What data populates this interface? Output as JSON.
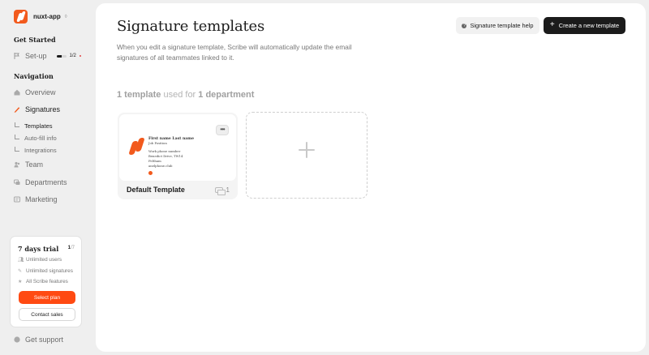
{
  "brand": {
    "name": "nuxt-app",
    "caret": "◊"
  },
  "sidebar": {
    "get_started_title": "Get Started",
    "setup": {
      "label": "Set-up",
      "progress_text": "1/2",
      "progress_fraction": 0.5
    },
    "navigation_title": "Navigation",
    "items": [
      {
        "label": "Overview",
        "icon": "home-icon"
      },
      {
        "label": "Signatures",
        "icon": "pen-icon"
      },
      {
        "label": "Team",
        "icon": "people-icon"
      },
      {
        "label": "Departments",
        "icon": "departments-icon"
      },
      {
        "label": "Marketing",
        "icon": "megaphone-icon"
      }
    ],
    "sub_items": [
      {
        "label": "Templates"
      },
      {
        "label": "Auto-fill info"
      },
      {
        "label": "Integrations"
      }
    ],
    "support_label": "Get support"
  },
  "trial": {
    "title": "7 days trial",
    "count_current": "1",
    "count_total": "/7",
    "features": [
      "Unlimited users",
      "Unlimited signatures",
      "All Scribe features"
    ],
    "select_plan": "Select plan",
    "contact_sales": "Contact sales"
  },
  "main": {
    "title": "Signature templates",
    "description": "When you edit a signature template, Scribe will automatically update the email signatures of all teammates linked to it.",
    "help_button": "Signature template help",
    "create_button": "Create a new template",
    "summary": {
      "templates": "1 template",
      "used_for": " used for ",
      "departments": "1 department"
    }
  },
  "templates": [
    {
      "name": "Default Template",
      "department_count": "1",
      "preview": {
        "full_name": "First name Last name",
        "position": "Job Position",
        "phone": "Work phone number",
        "address_line1": "Benedict Drive, TW14",
        "address_line2": "Feltham",
        "website": "anelphone.club"
      }
    }
  ],
  "colors": {
    "accent": "#ff4a12",
    "logo": "#f25a1d",
    "primary_button": "#1b1b1b"
  }
}
